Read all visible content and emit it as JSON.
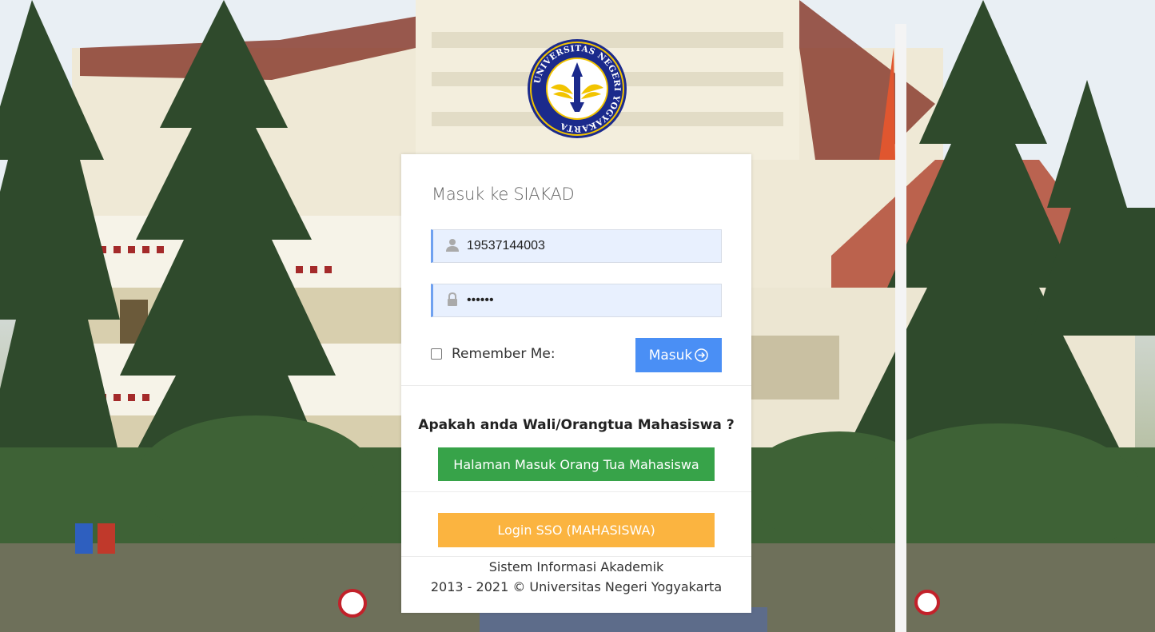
{
  "login": {
    "title": "Masuk ke SIAKAD",
    "username_value": "19537144003",
    "password_value": "••••••",
    "remember_label": "Remember Me:",
    "submit_label": "Masuk"
  },
  "parent": {
    "question": "Apakah anda Wali/Orangtua Mahasiswa ?",
    "button_label": "Halaman Masuk Orang Tua Mahasiswa"
  },
  "sso": {
    "button_label": "Login SSO (MAHASISWA)"
  },
  "footer": {
    "line1": "Sistem Informasi Akademik",
    "line2": "2013 - 2021 © Universitas Negeri Yogyakarta"
  },
  "logo": {
    "ring_text": "UNIVERSITAS NEGERI YOGYAKARTA"
  },
  "icons": {
    "user": "user-icon",
    "lock": "lock-icon",
    "arrow": "arrow-circle-right-icon"
  },
  "colors": {
    "primary": "#4a8ff5",
    "success": "#37a349",
    "warning": "#fbb440",
    "input_bg": "#e8f0fe",
    "logo_blue": "#1b2a8c",
    "logo_gold": "#f2c400"
  }
}
